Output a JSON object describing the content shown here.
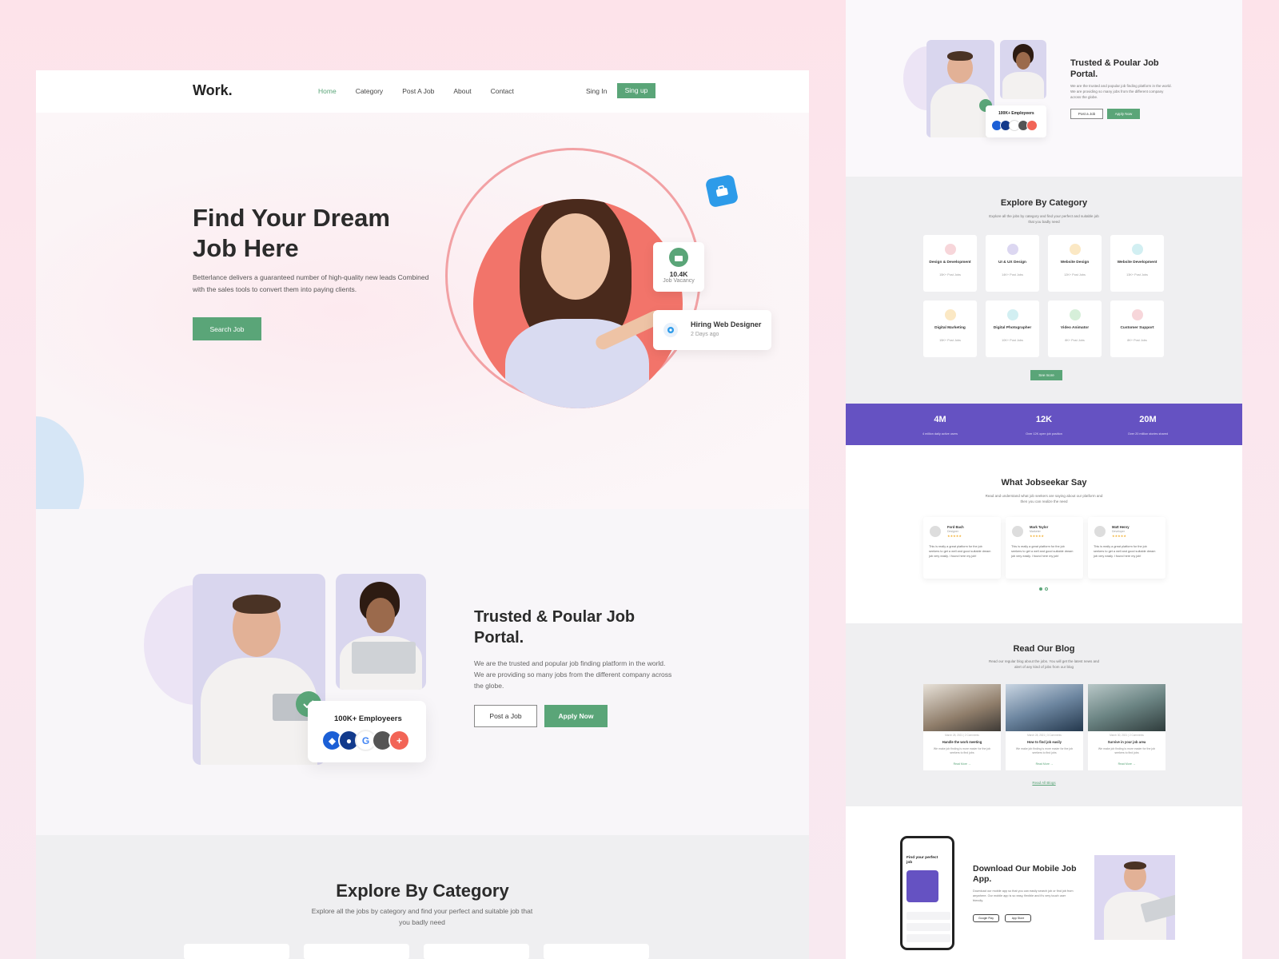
{
  "nav": {
    "logo": "Work.",
    "links": [
      "Home",
      "Category",
      "Post A Job",
      "About",
      "Contact"
    ],
    "signin": "Sing In",
    "signup": "Sing up"
  },
  "hero": {
    "title": "Find Your Dream Job Here",
    "subtitle": "Betterlance delivers a guaranteed number of high-quality new leads Combined with the sales tools to convert them into paying clients.",
    "cta": "Search Job",
    "vacancy_count": "10.4K",
    "vacancy_label": "Job Vacancy",
    "hiring_title": "Hiring Web Designer",
    "hiring_time": "2 Days ago"
  },
  "trusted": {
    "title": "Trusted & Poular Job Portal.",
    "text": "We are the trusted and popular job finding platform in the world. We are providing so many jobs from the different company across the globe.",
    "employers": "100K+ Employeers",
    "post_btn": "Post a Job",
    "apply_btn": "Apply Now"
  },
  "explore": {
    "title": "Explore By Category",
    "subtitle": "Explore all the jobs by category and find your perfect and suitable job that you badly need"
  },
  "right": {
    "trusted_title": "Trusted & Poular Job Portal.",
    "trusted_text": "We are the trusted and popular job finding platform in the world. We are providing so many jobs from the different company across the globe.",
    "employers": "100K+ Employeers",
    "post_btn": "Post a Job",
    "apply_btn": "Apply Now",
    "cat_title": "Explore By Category",
    "cat_sub": "Explore all the jobs by category and find your perfect and suitable job that you badly need",
    "categories": [
      {
        "name": "Design & Development",
        "count": "15K+ Post Jobs",
        "color": "#f7d6da"
      },
      {
        "name": "UI & UX Design",
        "count": "14K+ Post Jobs",
        "color": "#dcd7f1"
      },
      {
        "name": "Website Design",
        "count": "12K+ Post Jobs",
        "color": "#fbe8c4"
      },
      {
        "name": "Website Development",
        "count": "13K+ Post Jobs",
        "color": "#d2eff2"
      },
      {
        "name": "Digital Marketing",
        "count": "15K+ Post Jobs",
        "color": "#fbe8c4"
      },
      {
        "name": "Digital Photographer",
        "count": "10K+ Post Jobs",
        "color": "#d2eff2"
      },
      {
        "name": "Video Animator",
        "count": "8K+ Post Jobs",
        "color": "#d6efd9"
      },
      {
        "name": "Customer Support",
        "count": "8K+ Post Jobs",
        "color": "#f7d6da"
      }
    ],
    "see_more": "See more",
    "stats": [
      {
        "value": "4M",
        "label": "4 million daily active users"
      },
      {
        "value": "12K",
        "label": "Over 12K open job position"
      },
      {
        "value": "20M",
        "label": "Over 20 million stories shared"
      }
    ],
    "testi_title": "What Jobseekar Say",
    "testi_sub": "Read and understand what job seekers are saying about our platform and then you can realize the need",
    "testimonials": [
      {
        "name": "Ford Bach",
        "role": "Designer",
        "stars": "★★★★★",
        "text": "This is really a great platform for the job seekers to get a well and good suitable dream job very easily. I found here my job!"
      },
      {
        "name": "Mark Taylor",
        "role": "Marketer",
        "stars": "★★★★★",
        "text": "This is really a great platform for the job seekers to get a well and good suitable dream job very easily. I found here my job!"
      },
      {
        "name": "Matt Henry",
        "role": "Developer",
        "stars": "★★★★★",
        "text": "This is really a great platform for the job seekers to get a well and good suitable dream job very easily. I found here my job!"
      }
    ],
    "blog_title": "Read Our Blog",
    "blog_sub": "Read our regular blog about the jobs. You will get the latest news and alert of any kind of jobs from our blog",
    "blogs": [
      {
        "meta": "March 28, 2021  |  2 Comments",
        "title": "Handle the work meeting",
        "text": "We make job finding is more easier for the job seekers to find jobs",
        "more": "Read More →"
      },
      {
        "meta": "March 28, 2021  |  3 Comments",
        "title": "How to find job easily",
        "text": "We make job finding is more easier for the job seekers to find jobs",
        "more": "Read More →"
      },
      {
        "meta": "March 30, 2021  |  2 Comments",
        "title": "Survive in your job area",
        "text": "We make job finding is more easier for the job seekers to find jobs",
        "more": "Read More →"
      }
    ],
    "blog_all": "Read All Blogs",
    "app_title": "Download Our Mobile Job App.",
    "app_text": "Download our mobile app so that you can easily search job or find job from anywhere. Our mobile app is so easy, flexible and it's very touch user friendly.",
    "phone_title": "Find your perfect job",
    "store1": "Google Play",
    "store2": "App Store"
  }
}
